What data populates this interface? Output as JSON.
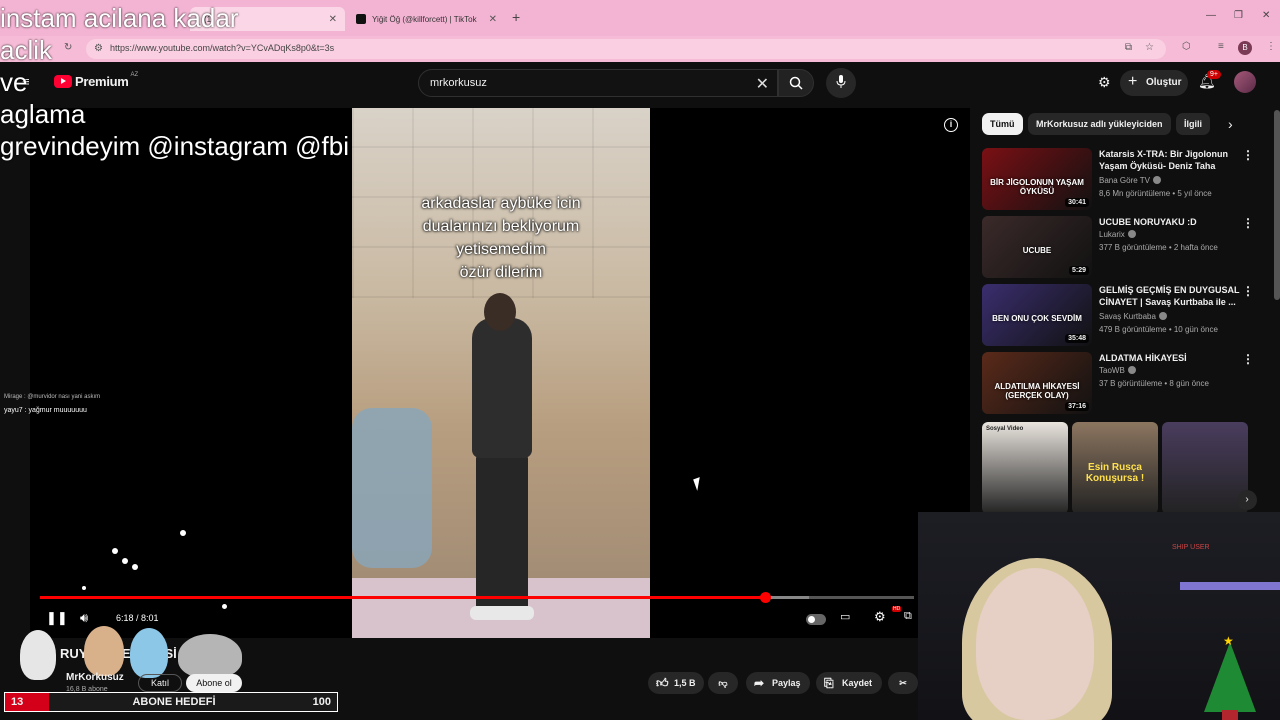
{
  "overlay": {
    "lines": "instam acilana kadar\naclik\nve\naglama\ngrevindeyim @instagram @fbi"
  },
  "browser": {
    "tab_active": "(1)",
    "tab_other": "Yiğit Öğ (@killforcett) | TikTok",
    "url": "https://www.youtube.com/watch?v=YCvADqKs8p0&t=3s",
    "profile_initial": "B"
  },
  "youtube": {
    "logo_text": "Premium",
    "logo_region": "AZ",
    "search_value": "mrkorkusuz",
    "create_label": "Oluştur",
    "notif_count": "9+"
  },
  "player": {
    "caption": "arkadaslar aybüke icin\ndualarınızı bekliyorum\nyetisemedim\nözür dilerim",
    "time": "6:18 / 8:01",
    "progress_fraction": 0.83,
    "buffer_fraction": 0.88
  },
  "chat": {
    "line1": "Mirage : @murvidor nası yani askım",
    "line2": "yayu7 : yağmur muuuuuuu"
  },
  "video": {
    "title": "RUYA ... SEVGİLİSİ",
    "channel": "MrKorkusuz",
    "subs": "16,8 B abone",
    "join_label": "Katıl",
    "subscribe_label": "Abone ol",
    "likes": "1,5 B",
    "share_label": "Paylaş",
    "save_label": "Kaydet"
  },
  "goal": {
    "current": "13",
    "label": "ABONE HEDEFİ",
    "target": "100"
  },
  "chips": [
    "Tümü",
    "MrKorkusuz adlı yükleyiciden",
    "İlgili"
  ],
  "recommendations": [
    {
      "title": "Katarsis X-TRA: Bir Jigolonun Yaşam Öyküsü- Deniz Taha",
      "channel": "Bana Göre TV",
      "meta": "8,6 Mn görüntüleme • 5 yıl önce",
      "duration": "30:41",
      "thumb_text": "BİR JİGOLONUN YAŞAM ÖYKÜSÜ",
      "color": "#7a1014"
    },
    {
      "title": "UCUBE NORUYAKU :D",
      "channel": "Lukarix",
      "meta": "377 B görüntüleme • 2 hafta önce",
      "duration": "5:29",
      "thumb_text": "UCUBE",
      "color": "#3b2a2a"
    },
    {
      "title": "GELMİŞ GEÇMİŞ EN DUYGUSAL CİNAYET | Savaş Kurtbaba ile ...",
      "channel": "Savaş Kurtbaba",
      "meta": "479 B görüntüleme • 10 gün önce",
      "duration": "35:48",
      "thumb_text": "BEN ONU ÇOK SEVDİM",
      "color": "#3a2e6e"
    },
    {
      "title": "ALDATMA HİKAYESİ",
      "channel": "TaoWB",
      "meta": "37 B görüntüleme • 8 gün önce",
      "duration": "37:16",
      "thumb_text": "ALDATILMA HİKAYESİ (GERÇEK OLAY)",
      "color": "#5a2a1a"
    }
  ],
  "shorts": [
    {
      "text": "Sosyal Video",
      "color": "#e9e4de"
    },
    {
      "text": "Esin Rusça Konuşursa !",
      "color": "#8c7660"
    },
    {
      "text": "",
      "color": "#4a3d5e"
    }
  ],
  "webcam": {
    "sign": "SHIP USER"
  }
}
